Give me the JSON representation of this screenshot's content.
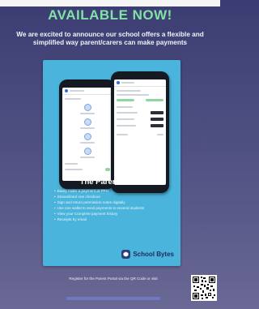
{
  "banner": {
    "title": "AVAILABLE NOW!",
    "intro": "We are excited to announce our school offers a flexible and simplified way parent/carers can make payments"
  },
  "portal": {
    "title": "The Parent Portal",
    "features": [
      "Easily make a payment at PPH",
      "Streamlined one checkout",
      "Sign and return permission notes digitally",
      "Use one wallet to send payments to several students",
      "View your Complete payment history",
      "Receipts by email"
    ]
  },
  "brand": {
    "name": "School Bytes",
    "icon": "school-bytes-logo-icon"
  },
  "footer": {
    "register_text": "Register for the Parent Portal via the QR Code or visit"
  },
  "colors": {
    "background": "#3b3d72",
    "title_green": "#7fe3a4",
    "panel_blue": "#4ab4dc",
    "brand_navy": "#1f2c5c"
  }
}
